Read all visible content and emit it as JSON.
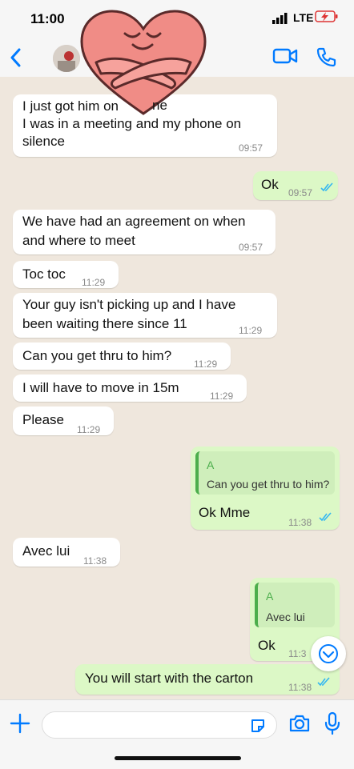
{
  "status_bar": {
    "time": "11:00",
    "network": "LTE"
  },
  "messages": [
    {
      "dir": "in",
      "lines": [
        "I just got him on",
        "I was in a meeting and my phone on",
        "silence"
      ],
      "line2_top_fix": "",
      "time": "09:57"
    },
    {
      "dir": "out",
      "lines": [
        "Ok"
      ],
      "time": "09:57"
    },
    {
      "dir": "in",
      "lines": [
        "We have had an agreement on when",
        "and where to meet"
      ],
      "time": "09:57"
    },
    {
      "dir": "in",
      "lines": [
        "Toc toc"
      ],
      "time": "11:29"
    },
    {
      "dir": "in",
      "lines": [
        "Your guy isn't picking up and I have",
        "been waiting there since 11"
      ],
      "time": "11:29"
    },
    {
      "dir": "in",
      "lines": [
        "Can you get thru to him?"
      ],
      "time": "11:29"
    },
    {
      "dir": "in",
      "lines": [
        "I will have to move in 15m"
      ],
      "time": "11:29"
    },
    {
      "dir": "in",
      "lines": [
        "Please"
      ],
      "time": "11:29"
    },
    {
      "dir": "out",
      "quote_author": "A",
      "quote_text": "Can you get thru to him?",
      "lines": [
        "Ok Mme"
      ],
      "time": "11:38"
    },
    {
      "dir": "in",
      "lines": [
        "Avec lui"
      ],
      "time": "11:38"
    },
    {
      "dir": "out",
      "quote_author": "A",
      "quote_text": "Avec lui",
      "lines": [
        "Ok"
      ],
      "time": "11:3"
    },
    {
      "dir": "out",
      "lines": [
        "You will start with the carton"
      ],
      "time": "11:38"
    }
  ],
  "first_line_fragment": "ne",
  "colors": {
    "accent": "#007aff",
    "incoming": "#ffffff",
    "outgoing": "#dcf8c6",
    "quote_bar": "#4cae4c",
    "read_ticks": "#34b7f1"
  },
  "icons": [
    "back-chevron-icon",
    "video-call-icon",
    "phone-icon",
    "plus-icon",
    "sticker-icon",
    "camera-icon",
    "microphone-icon",
    "scroll-down-icon",
    "heart-hug-sticker"
  ]
}
